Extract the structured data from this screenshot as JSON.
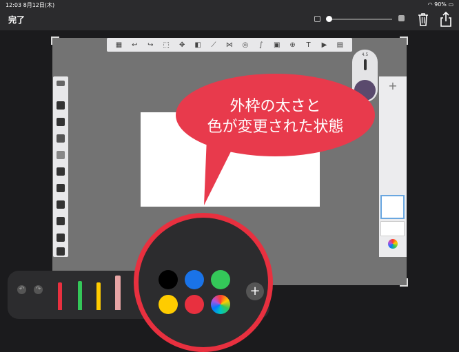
{
  "status": {
    "time": "12:03",
    "date": "8月12日(木)",
    "battery": "90%"
  },
  "topbar": {
    "done_label": "完了"
  },
  "color_widget": {
    "size_label": "4.5",
    "current_color": "#5a4a6d"
  },
  "layers": {
    "add_label": "+"
  },
  "callout": {
    "line1": "外枠の太さと",
    "line2": "色が変更された状態"
  },
  "palette": {
    "colors": [
      "#000000",
      "#1a73e8",
      "#34c759",
      "#ffcc00",
      "#e8303f",
      "color-wheel"
    ],
    "add_label": "+"
  },
  "bottom": {
    "undo_icon": "undo-icon",
    "redo_icon": "redo-icon"
  }
}
